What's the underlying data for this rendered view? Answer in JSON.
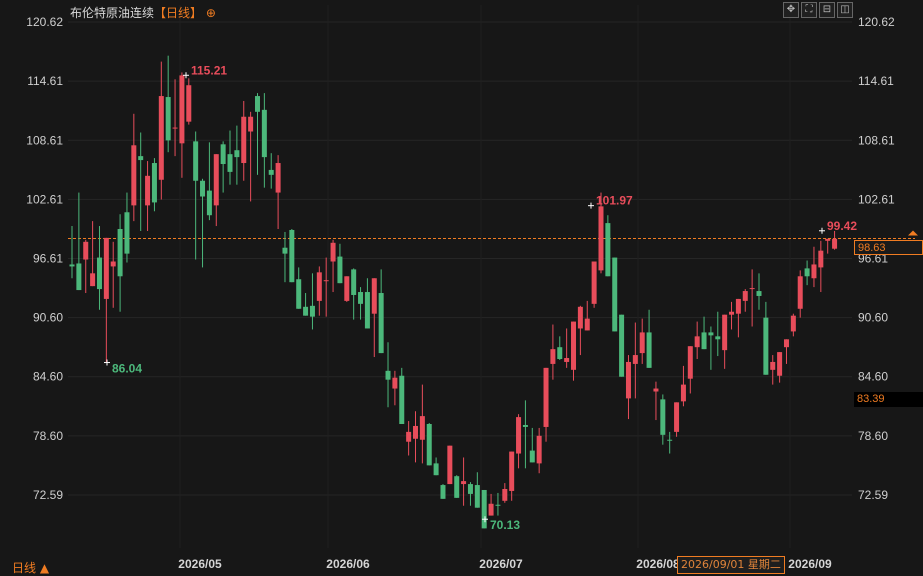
{
  "title": {
    "name": "布伦特原油连续",
    "period_tag": "【日线】",
    "plus_icon": "circle-plus-icon"
  },
  "toolbar": {
    "icons": [
      "move-icon",
      "fullscreen-icon",
      "zoom-out-icon",
      "fit-icon"
    ]
  },
  "period_label": "日线 ▲",
  "cursor_tooltip": "2026/09/01 星期二",
  "price_tags": {
    "current": "98.63",
    "secondary": "83.39"
  },
  "colors": {
    "up": "#e84d5b",
    "down": "#4cb87b",
    "background": "#171717",
    "accent": "#f07c22",
    "grid": "#262626"
  },
  "chart_data": {
    "type": "candlestick",
    "y_ticks": [
      120.62,
      114.61,
      108.61,
      102.61,
      96.61,
      90.6,
      84.6,
      78.6,
      72.59
    ],
    "y_range": [
      70.13,
      120.62
    ],
    "x_labels": [
      "2026/05",
      "2026/06",
      "2026/07",
      "2026/08",
      "2026/09"
    ],
    "reference_line": 98.63,
    "annotations": [
      {
        "label": "115.21",
        "value": 115.21,
        "kind": "high"
      },
      {
        "label": "86.04",
        "value": 86.04,
        "kind": "low"
      },
      {
        "label": "101.97",
        "value": 101.97,
        "kind": "high"
      },
      {
        "label": "70.13",
        "value": 70.13,
        "kind": "low"
      },
      {
        "label": "99.42",
        "value": 99.42,
        "kind": "high"
      }
    ],
    "candles": [
      [
        96.0,
        99.9,
        94.6,
        95.8
      ],
      [
        96.1,
        103.3,
        93.4,
        93.4
      ],
      [
        96.5,
        98.5,
        93.1,
        98.3
      ],
      [
        93.8,
        100.4,
        94.3,
        95.1
      ],
      [
        96.7,
        99.9,
        91.4,
        93.5
      ],
      [
        92.5,
        97.2,
        86.0,
        98.7
      ],
      [
        95.8,
        98.3,
        91.6,
        96.3
      ],
      [
        99.6,
        101.1,
        91.2,
        94.8
      ],
      [
        101.3,
        103.3,
        96.2,
        97.1
      ],
      [
        102.0,
        111.3,
        100.4,
        108.1
      ],
      [
        107.0,
        109.4,
        99.4,
        106.6
      ],
      [
        102.0,
        106.5,
        99.4,
        105.0
      ],
      [
        106.3,
        106.8,
        101.4,
        102.3
      ],
      [
        104.6,
        116.6,
        102.6,
        113.1
      ],
      [
        113.0,
        117.2,
        107.4,
        108.6
      ],
      [
        109.9,
        114.8,
        107.0,
        109.9
      ],
      [
        108.3,
        115.5,
        104.8,
        115.2
      ],
      [
        110.5,
        114.9,
        110.2,
        114.2
      ],
      [
        108.5,
        109.5,
        96.5,
        104.5
      ],
      [
        104.5,
        104.7,
        95.7,
        102.9
      ],
      [
        103.5,
        108.4,
        100.5,
        101.0
      ],
      [
        102.0,
        105.5,
        99.9,
        107.2
      ],
      [
        108.2,
        108.5,
        103.3,
        106.2
      ],
      [
        107.2,
        109.6,
        104.1,
        105.4
      ],
      [
        107.6,
        110.1,
        104.1,
        106.9
      ],
      [
        106.3,
        112.6,
        104.5,
        111.0
      ],
      [
        109.5,
        111.5,
        102.4,
        111.0
      ],
      [
        113.1,
        113.4,
        105.1,
        111.5
      ],
      [
        111.7,
        113.4,
        103.8,
        106.9
      ],
      [
        105.6,
        107.3,
        103.7,
        105.1
      ],
      [
        103.3,
        107.1,
        99.6,
        106.3
      ],
      [
        97.7,
        99.3,
        94.2,
        97.1
      ],
      [
        99.5,
        99.6,
        95.2,
        94.2
      ],
      [
        94.5,
        95.7,
        91.9,
        91.5
      ],
      [
        91.7,
        93.1,
        91.2,
        90.8
      ],
      [
        91.8,
        95.1,
        89.4,
        90.7
      ],
      [
        92.3,
        95.8,
        90.8,
        95.2
      ],
      [
        94.3,
        96.7,
        90.7,
        94.4
      ],
      [
        96.3,
        98.5,
        93.2,
        98.2
      ],
      [
        96.8,
        98.1,
        95.2,
        94.1
      ],
      [
        92.3,
        94.3,
        92.2,
        94.8
      ],
      [
        95.5,
        95.6,
        90.4,
        92.9
      ],
      [
        93.2,
        93.7,
        90.4,
        92.0
      ],
      [
        93.2,
        94.6,
        91.0,
        89.5
      ],
      [
        91.0,
        92.2,
        86.6,
        94.6
      ],
      [
        93.1,
        95.5,
        88.3,
        87.0
      ],
      [
        85.2,
        88.1,
        81.5,
        84.3
      ],
      [
        83.4,
        85.2,
        81.7,
        84.5
      ],
      [
        84.7,
        85.5,
        83.5,
        79.8
      ],
      [
        78.0,
        80.1,
        76.6,
        79.0
      ],
      [
        78.3,
        81.1,
        75.9,
        79.6
      ],
      [
        78.2,
        83.8,
        75.8,
        80.6
      ],
      [
        79.8,
        79.9,
        76.1,
        75.6
      ],
      [
        75.8,
        76.4,
        75.4,
        74.6
      ],
      [
        73.6,
        73.7,
        72.5,
        72.2
      ],
      [
        73.7,
        76.3,
        74.8,
        77.6
      ],
      [
        74.5,
        74.6,
        72.4,
        72.3
      ],
      [
        73.7,
        76.4,
        71.5,
        74.0
      ],
      [
        73.7,
        73.9,
        71.5,
        72.7
      ],
      [
        73.6,
        74.9,
        73.1,
        71.3
      ],
      [
        73.1,
        73.1,
        69.9,
        69.2
      ],
      [
        70.5,
        72.7,
        72.2,
        71.7
      ],
      [
        71.6,
        72.8,
        70.5,
        71.5
      ],
      [
        72.0,
        73.8,
        71.8,
        73.2
      ],
      [
        73.0,
        75.8,
        72.0,
        77.0
      ],
      [
        76.8,
        80.8,
        75.3,
        80.5
      ],
      [
        79.7,
        82.2,
        75.3,
        79.5
      ],
      [
        77.1,
        79.4,
        76.9,
        75.9
      ],
      [
        75.8,
        79.4,
        74.8,
        78.6
      ],
      [
        79.5,
        84.8,
        78.0,
        85.5
      ],
      [
        85.9,
        89.9,
        84.3,
        87.4
      ],
      [
        87.6,
        88.7,
        86.3,
        86.4
      ],
      [
        86.1,
        89.5,
        85.5,
        86.5
      ],
      [
        85.3,
        89.2,
        84.2,
        90.2
      ],
      [
        89.5,
        91.8,
        86.8,
        91.7
      ],
      [
        89.3,
        92.3,
        89.3,
        90.5
      ],
      [
        92.0,
        95.3,
        91.6,
        96.3
      ],
      [
        95.4,
        103.3,
        95.1,
        101.9
      ],
      [
        100.2,
        101.0,
        96.6,
        94.8
      ],
      [
        96.7,
        94.6,
        89.5,
        89.2
      ],
      [
        90.9,
        90.5,
        87.9,
        84.6
      ],
      [
        82.4,
        86.8,
        80.3,
        86.1
      ],
      [
        85.9,
        90.1,
        82.4,
        86.8
      ],
      [
        87.0,
        90.5,
        85.9,
        89.1
      ],
      [
        89.1,
        91.4,
        85.6,
        85.5
      ],
      [
        83.1,
        84.1,
        80.2,
        83.4
      ],
      [
        82.3,
        82.8,
        77.7,
        78.7
      ],
      [
        78.2,
        79.0,
        76.8,
        78.1
      ],
      [
        79.0,
        81.7,
        78.5,
        82.0
      ],
      [
        82.1,
        85.7,
        81.6,
        83.8
      ],
      [
        84.4,
        87.6,
        82.9,
        87.7
      ],
      [
        87.6,
        90.2,
        86.4,
        88.7
      ],
      [
        89.1,
        90.7,
        87.4,
        87.4
      ],
      [
        89.1,
        89.7,
        85.3,
        88.8
      ],
      [
        88.7,
        91.2,
        86.7,
        88.4
      ],
      [
        87.3,
        90.8,
        85.4,
        90.9
      ],
      [
        90.9,
        92.2,
        89.4,
        91.2
      ],
      [
        91.0,
        92.5,
        88.6,
        92.5
      ],
      [
        92.3,
        93.5,
        91.2,
        93.3
      ],
      [
        93.6,
        95.5,
        89.7,
        93.6
      ],
      [
        93.3,
        95.1,
        91.4,
        92.8
      ],
      [
        90.6,
        92.2,
        87.4,
        84.8
      ],
      [
        85.3,
        86.8,
        83.8,
        86.1
      ],
      [
        84.7,
        86.8,
        84.0,
        87.1
      ],
      [
        87.6,
        88.1,
        85.9,
        88.4
      ],
      [
        89.2,
        91.0,
        88.7,
        90.8
      ],
      [
        91.5,
        95.4,
        90.6,
        94.8
      ],
      [
        95.6,
        96.4,
        93.9,
        94.8
      ],
      [
        94.6,
        97.8,
        93.7,
        96.0
      ],
      [
        95.7,
        98.4,
        93.2,
        97.4
      ],
      [
        98.4,
        98.4,
        97.1,
        98.6
      ],
      [
        97.6,
        99.4,
        97.5,
        98.6
      ]
    ]
  }
}
